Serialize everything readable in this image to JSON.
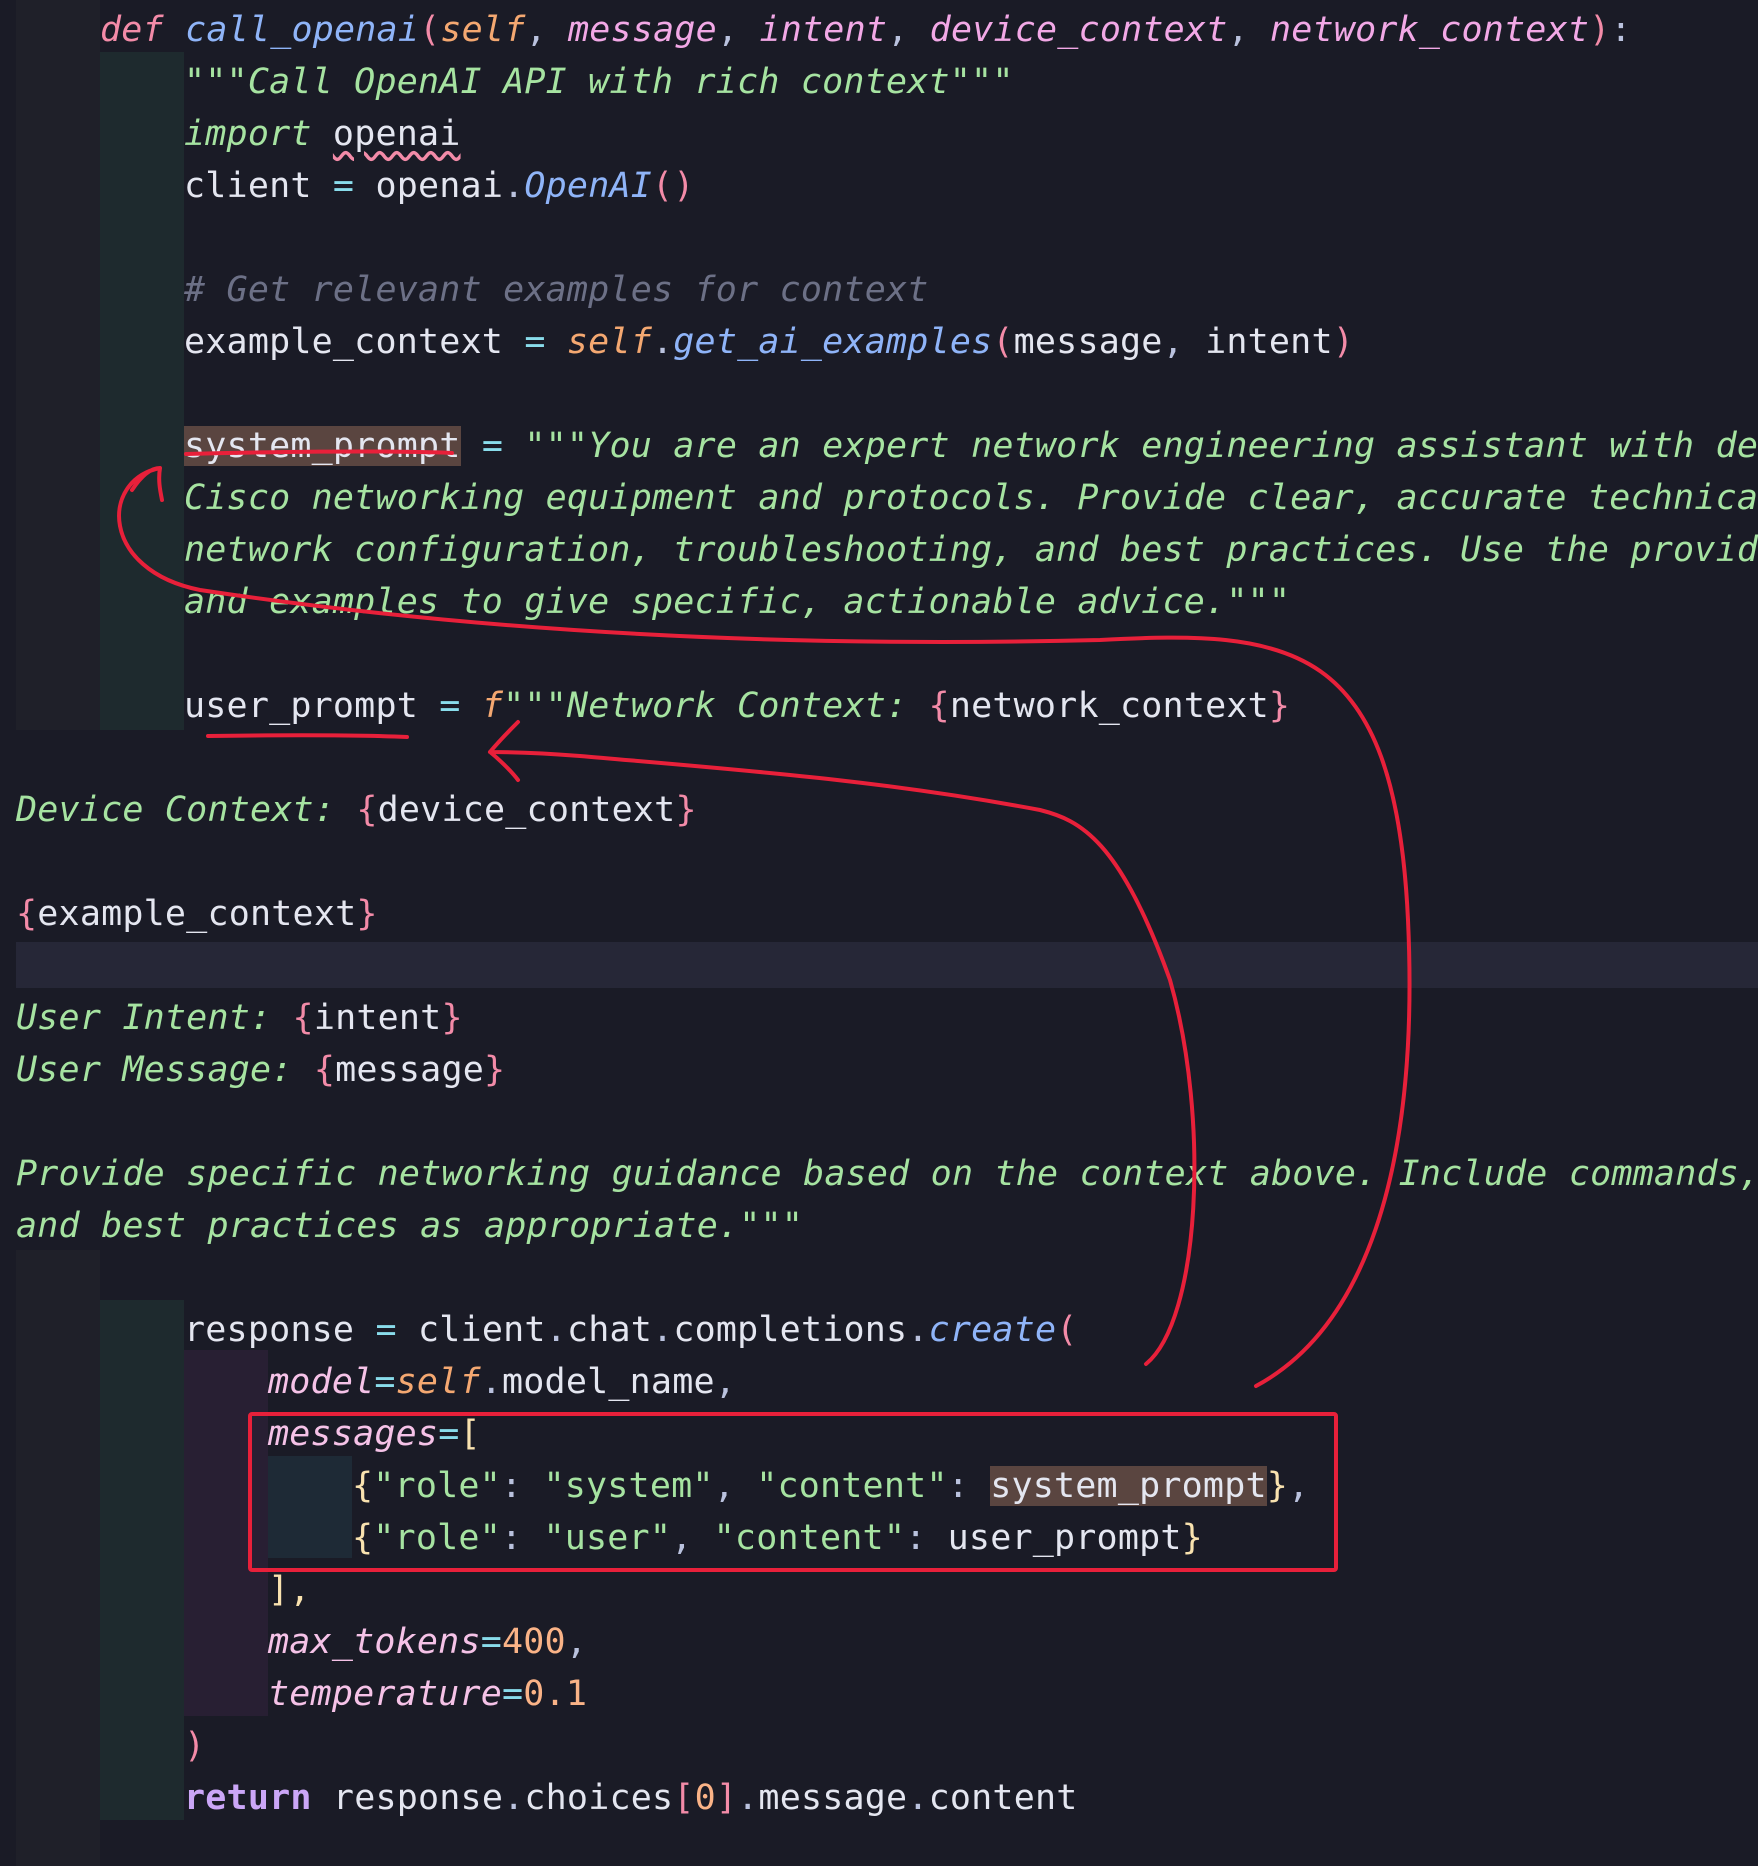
{
  "lines": [
    {
      "id": "l1",
      "segs": [
        [
          "def",
          "kw"
        ],
        [
          " ",
          ""
        ],
        [
          "call_openai",
          "fn"
        ],
        [
          "(",
          "brk"
        ],
        [
          "self",
          "slf"
        ],
        [
          ", ",
          "pun"
        ],
        [
          "message",
          "prm"
        ],
        [
          ", ",
          "pun"
        ],
        [
          "intent",
          "prm"
        ],
        [
          ", ",
          "pun"
        ],
        [
          "device_context",
          "prm"
        ],
        [
          ", ",
          "pun"
        ],
        [
          "network_context",
          "prm"
        ],
        [
          ")",
          "brk"
        ],
        [
          ":",
          "pun"
        ]
      ]
    },
    {
      "id": "l2",
      "segs": [
        [
          "\"\"\"Call OpenAI API with rich context\"\"\"",
          "str"
        ]
      ]
    },
    {
      "id": "l3",
      "segs": [
        [
          "import",
          "str"
        ],
        [
          " ",
          ""
        ],
        [
          "openai",
          "var squiggle"
        ]
      ]
    },
    {
      "id": "l4",
      "segs": [
        [
          "client",
          "var"
        ],
        [
          " = ",
          "op"
        ],
        [
          "openai",
          "var"
        ],
        [
          ".",
          "pun"
        ],
        [
          "OpenAI",
          "fn"
        ],
        [
          "()",
          "brk"
        ]
      ]
    },
    {
      "id": "l5",
      "segs": [
        [
          "# Get relevant examples for context",
          "cmt"
        ]
      ]
    },
    {
      "id": "l6",
      "segs": [
        [
          "example_context",
          "var"
        ],
        [
          " = ",
          "op"
        ],
        [
          "self",
          "slf"
        ],
        [
          ".",
          "pun"
        ],
        [
          "get_ai_examples",
          "fn"
        ],
        [
          "(",
          "brk"
        ],
        [
          "message",
          "var"
        ],
        [
          ", ",
          "pun"
        ],
        [
          "intent",
          "var"
        ],
        [
          ")",
          "brk"
        ]
      ]
    },
    {
      "id": "l7",
      "segs": [
        [
          "system_prompt",
          "var hl-word"
        ],
        [
          " = ",
          "op"
        ],
        [
          "\"\"\"You are an expert network engineering assistant with deep",
          "str"
        ]
      ]
    },
    {
      "id": "l8",
      "segs": [
        [
          "Cisco networking equipment and protocols. Provide clear, accurate technical",
          "str"
        ]
      ]
    },
    {
      "id": "l9",
      "segs": [
        [
          "network configuration, troubleshooting, and best practices. Use the provided",
          "str"
        ]
      ]
    },
    {
      "id": "l10",
      "segs": [
        [
          "and examples to give specific, actionable advice.\"\"\"",
          "str"
        ]
      ]
    },
    {
      "id": "l11",
      "segs": [
        [
          "user_prompt",
          "var"
        ],
        [
          " = ",
          "op"
        ],
        [
          "f",
          "slf"
        ],
        [
          "\"\"\"Network Context: ",
          "str"
        ],
        [
          "{",
          "brk"
        ],
        [
          "network_context",
          "var"
        ],
        [
          "}",
          "brk"
        ]
      ]
    },
    {
      "id": "l12",
      "segs": [
        [
          "Device Context: ",
          "str"
        ],
        [
          "{",
          "brk"
        ],
        [
          "device_context",
          "var"
        ],
        [
          "}",
          "brk"
        ]
      ]
    },
    {
      "id": "l13",
      "segs": [
        [
          "{",
          "brk"
        ],
        [
          "example_context",
          "var"
        ],
        [
          "}",
          "brk"
        ]
      ]
    },
    {
      "id": "l14",
      "segs": [
        [
          "User Intent: ",
          "str"
        ],
        [
          "{",
          "brk"
        ],
        [
          "intent",
          "var"
        ],
        [
          "}",
          "brk"
        ]
      ]
    },
    {
      "id": "l15",
      "segs": [
        [
          "User Message: ",
          "str"
        ],
        [
          "{",
          "brk"
        ],
        [
          "message",
          "var"
        ],
        [
          "}",
          "brk"
        ]
      ]
    },
    {
      "id": "l16",
      "segs": [
        [
          "Provide specific networking guidance based on the context above. Include commands, e",
          "str"
        ]
      ]
    },
    {
      "id": "l17",
      "segs": [
        [
          "and best practices as appropriate.\"\"\"",
          "str"
        ]
      ]
    },
    {
      "id": "l18",
      "segs": [
        [
          "response",
          "var"
        ],
        [
          " = ",
          "op"
        ],
        [
          "client",
          "var"
        ],
        [
          ".",
          "pun"
        ],
        [
          "chat",
          "var"
        ],
        [
          ".",
          "pun"
        ],
        [
          "completions",
          "var"
        ],
        [
          ".",
          "pun"
        ],
        [
          "create",
          "fn"
        ],
        [
          "(",
          "brk"
        ]
      ]
    },
    {
      "id": "l19",
      "segs": [
        [
          "model",
          "kwarg"
        ],
        [
          "=",
          "op"
        ],
        [
          "self",
          "slf"
        ],
        [
          ".",
          "pun"
        ],
        [
          "model_name",
          "var"
        ],
        [
          ",",
          "pun"
        ]
      ]
    },
    {
      "id": "l20",
      "segs": [
        [
          "messages",
          "kwarg"
        ],
        [
          "=",
          "op"
        ],
        [
          "[",
          "brk2"
        ]
      ]
    },
    {
      "id": "l21",
      "segs": [
        [
          "{",
          "brk2"
        ],
        [
          "\"role\"",
          "strn"
        ],
        [
          ": ",
          "pun"
        ],
        [
          "\"system\"",
          "strn"
        ],
        [
          ", ",
          "pun"
        ],
        [
          "\"content\"",
          "strn"
        ],
        [
          ": ",
          "pun"
        ],
        [
          "system_prompt",
          "var hl-word"
        ],
        [
          "}",
          "brk2"
        ],
        [
          ",",
          "pun"
        ]
      ]
    },
    {
      "id": "l22",
      "segs": [
        [
          "{",
          "brk2"
        ],
        [
          "\"role\"",
          "strn"
        ],
        [
          ": ",
          "pun"
        ],
        [
          "\"user\"",
          "strn"
        ],
        [
          ", ",
          "pun"
        ],
        [
          "\"content\"",
          "strn"
        ],
        [
          ": ",
          "pun"
        ],
        [
          "user_prompt",
          "var"
        ],
        [
          "}",
          "brk2"
        ]
      ]
    },
    {
      "id": "l23",
      "segs": [
        [
          "],",
          "brk2"
        ]
      ]
    },
    {
      "id": "l24",
      "segs": [
        [
          "max_tokens",
          "kwarg"
        ],
        [
          "=",
          "op"
        ],
        [
          "400",
          "num"
        ],
        [
          ",",
          "pun"
        ]
      ]
    },
    {
      "id": "l25",
      "segs": [
        [
          "temperature",
          "kwarg"
        ],
        [
          "=",
          "op"
        ],
        [
          "0.1",
          "num"
        ]
      ]
    },
    {
      "id": "l26",
      "segs": [
        [
          ")",
          "brk"
        ]
      ]
    },
    {
      "id": "l27",
      "segs": [
        [
          "return",
          "ret"
        ],
        [
          " ",
          ""
        ],
        [
          "response",
          "var"
        ],
        [
          ".",
          "pun"
        ],
        [
          "choices",
          "var"
        ],
        [
          "[",
          "brk"
        ],
        [
          "0",
          "num"
        ],
        [
          "]",
          "brk"
        ],
        [
          ".",
          "pun"
        ],
        [
          "message",
          "var"
        ],
        [
          ".",
          "pun"
        ],
        [
          "content",
          "var"
        ]
      ]
    }
  ],
  "annotations": {
    "color": "#e8203a",
    "box_label": "messages",
    "markup": [
      "underline-system-prompt",
      "underline-user-prompt",
      "arrow-to-system-prompt",
      "arrow-to-user-prompt",
      "box-messages"
    ]
  }
}
